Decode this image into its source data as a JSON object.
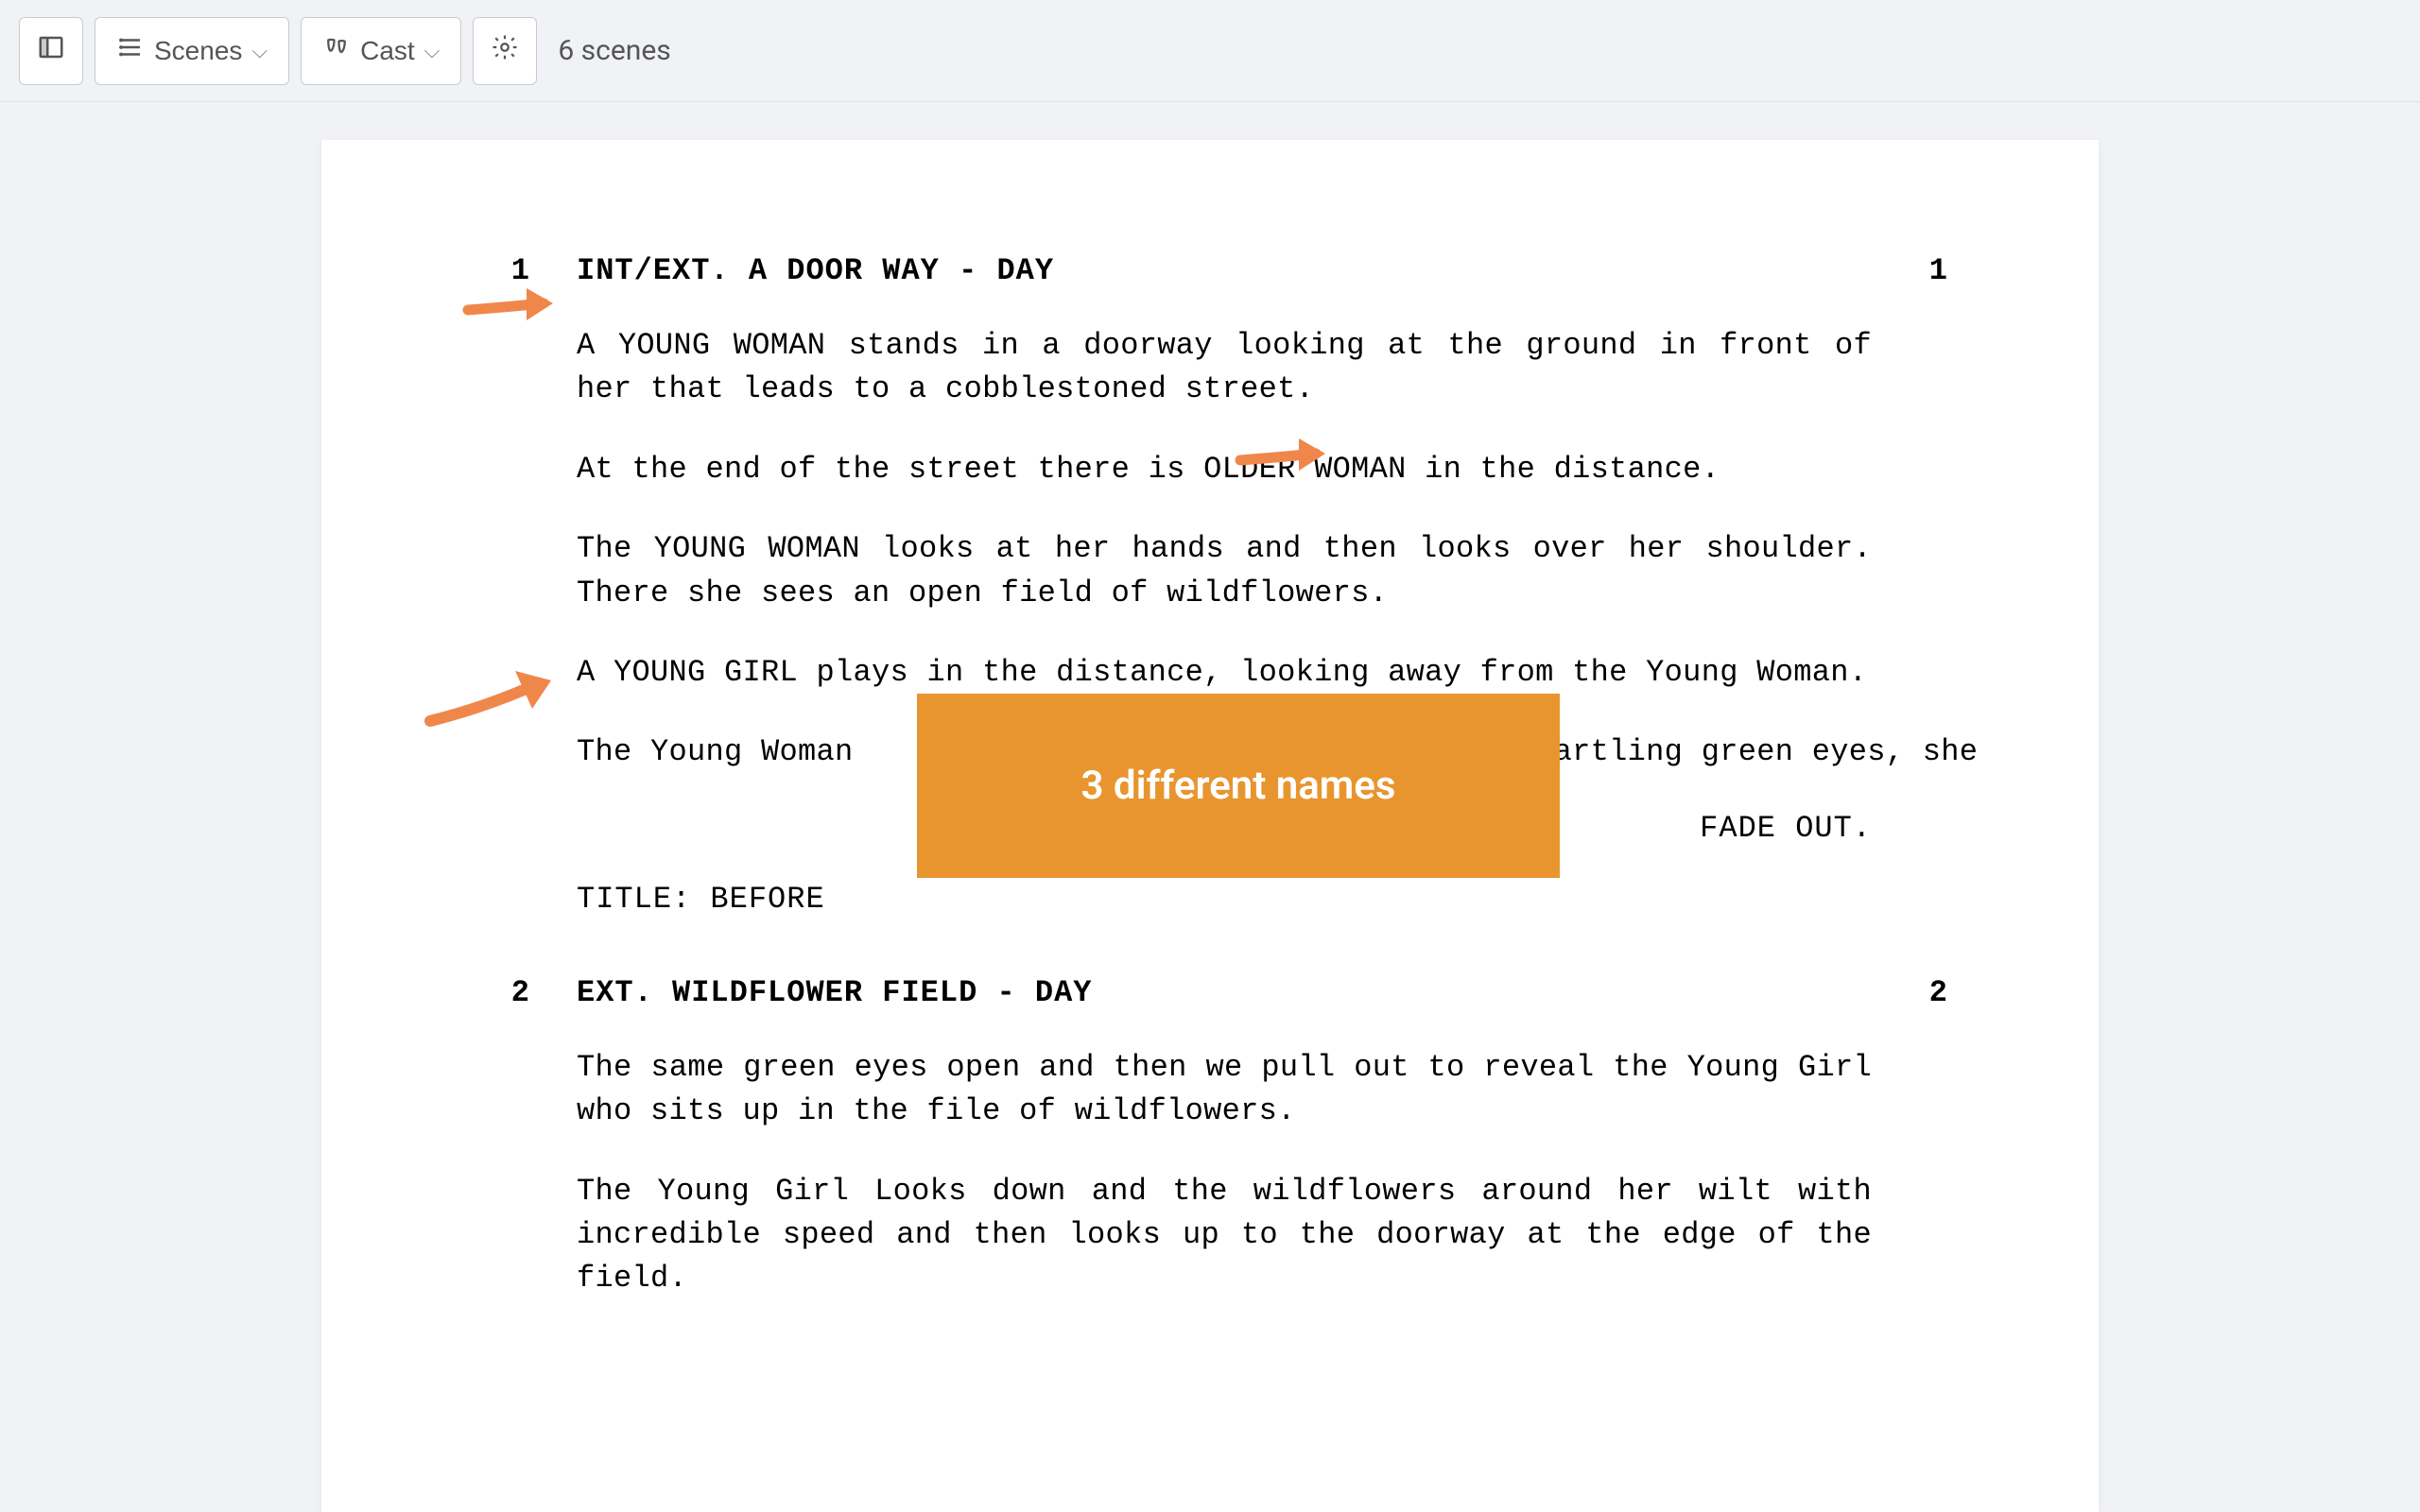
{
  "toolbar": {
    "scenes_label": "Scenes",
    "cast_label": "Cast",
    "scene_count": "6 scenes"
  },
  "scenes": [
    {
      "num": "1",
      "heading": "INT/EXT. A DOOR WAY - DAY",
      "actions": [
        "A YOUNG WOMAN stands in a doorway looking at the ground in front of her that leads to a cobblestoned street.",
        "At the end of the street there is    OLDER WOMAN in the distance.",
        "The YOUNG WOMAN looks at her hands and then looks over her shoulder. There she sees an open field of wildflowers.",
        "A YOUNG GIRL plays in the distance, looking away from the Young Woman.",
        "The Young Woman                                 on startling green eyes, she"
      ],
      "transition": "FADE OUT.",
      "title": "TITLE: BEFORE"
    },
    {
      "num": "2",
      "heading": "EXT. WILDFLOWER FIELD - DAY",
      "actions": [
        "The same green eyes open and then we pull out to reveal the Young Girl who sits up in the file of wildflowers.",
        "The Young Girl Looks down and the wildflowers around her wilt with incredible speed and then looks up to the doorway at the edge of the field."
      ]
    }
  ],
  "callout": {
    "label": "3 different names"
  },
  "colors": {
    "annotation_orange": "#e8952f",
    "arrow_orange": "#f0874a"
  }
}
